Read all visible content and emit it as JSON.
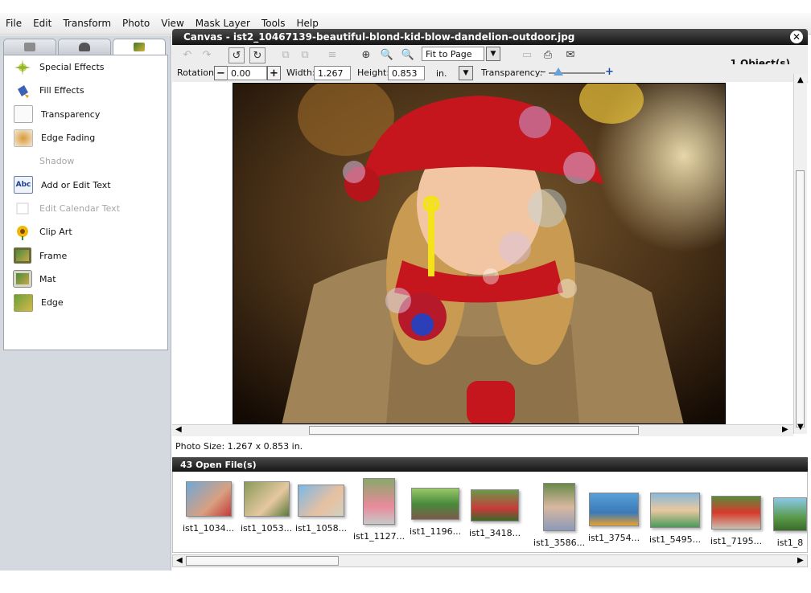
{
  "menu": [
    "File",
    "Edit",
    "Transform",
    "Photo",
    "View",
    "Mask Layer",
    "Tools",
    "Help"
  ],
  "left_tabs": [
    {
      "icon": "effects-tab-icon"
    },
    {
      "icon": "hat-tab-icon"
    },
    {
      "icon": "picture-tab-icon",
      "active": true
    }
  ],
  "effects": [
    {
      "label": "Special Effects",
      "icon": "sparkle-icon",
      "enabled": true
    },
    {
      "label": "Fill Effects",
      "icon": "paint-bucket-icon",
      "enabled": true
    },
    {
      "label": "Transparency",
      "icon": "transparency-icon",
      "enabled": true
    },
    {
      "label": "Edge Fading",
      "icon": "edge-fading-icon",
      "enabled": true
    },
    {
      "label": "Shadow",
      "icon": "shadow-icon",
      "enabled": false
    },
    {
      "label": "Add or Edit Text",
      "icon": "text-abc-icon",
      "enabled": true
    },
    {
      "label": "Edit Calendar Text",
      "icon": "calendar-text-icon",
      "enabled": false
    },
    {
      "label": "Clip Art",
      "icon": "sunflower-icon",
      "enabled": true
    },
    {
      "label": "Frame",
      "icon": "frame-icon",
      "enabled": true
    },
    {
      "label": "Mat",
      "icon": "mat-icon",
      "enabled": true
    },
    {
      "label": "Edge",
      "icon": "edge-icon",
      "enabled": true
    }
  ],
  "canvas": {
    "title": "Canvas - ist2_10467139-beautiful-blond-kid-blow-dandelion-outdoor.jpg",
    "zoom_option": "Fit to Page",
    "objects_count": "1 Object(s)",
    "rotation_label": "Rotation:",
    "rotation_value": "0.00",
    "width_label": "Width:",
    "width_value": "1.267",
    "height_label": "Height:",
    "height_value": "0.853",
    "unit": "in.",
    "transparency_label": "Transparency:",
    "transparency_minus": "–",
    "transparency_plus": "+",
    "photo_size": "Photo Size:  1.267 x 0.853 in."
  },
  "files": {
    "title": "43 Open File(s)",
    "items": [
      {
        "name": "ist1_1034..."
      },
      {
        "name": "ist1_1053..."
      },
      {
        "name": "ist1_1058..."
      },
      {
        "name": "ist1_1127..."
      },
      {
        "name": "ist1_1196..."
      },
      {
        "name": "ist1_3418..."
      },
      {
        "name": "ist1_3586..."
      },
      {
        "name": "ist1_3754..."
      },
      {
        "name": "ist1_5495..."
      },
      {
        "name": "ist1_7195..."
      },
      {
        "name": "ist1_8"
      }
    ]
  },
  "colors": {
    "title_bar": "#1e1e1e",
    "panel_bg": "#d4d9e0",
    "accent": "#6aa0d8"
  }
}
